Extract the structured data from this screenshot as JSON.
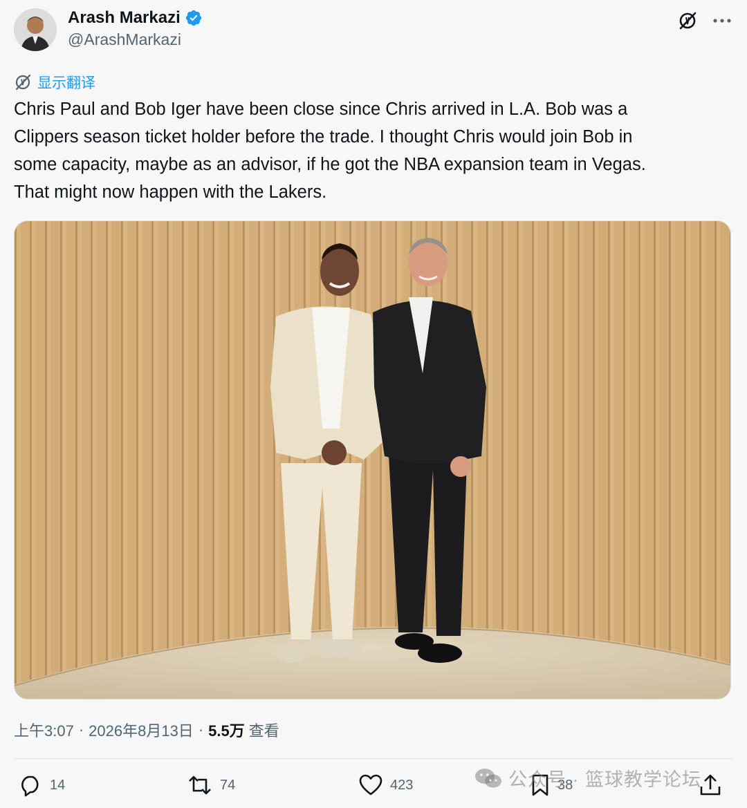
{
  "author": {
    "display_name": "Arash Markazi",
    "handle": "@ArashMarkazi",
    "verified": true
  },
  "translate": {
    "label": "显示翻译"
  },
  "tweet": {
    "lines": [
      "Chris Paul and Bob Iger have been close since Chris arrived in L.A. Bob was a",
      "Clippers season ticket holder before the trade. I thought Chris would join Bob in",
      "some capacity, maybe as an advisor, if he got the NBA expansion team in Vegas.",
      "That might now happen with the Lakers."
    ]
  },
  "meta": {
    "time": "上午3:07",
    "separator": "·",
    "date": "2026年8月13日",
    "views_count": "5.5万",
    "views_label": "查看"
  },
  "actions": {
    "replies": "14",
    "reposts": "74",
    "likes": "423",
    "bookmarks": "38"
  },
  "watermark": {
    "text": "公众号 · 篮球教学论坛"
  },
  "icons": {
    "translate": "no-translate-icon",
    "more": "more-dots-icon",
    "reply": "reply-icon",
    "repost": "repost-icon",
    "like": "heart-icon",
    "bookmark": "bookmark-icon",
    "share": "share-icon"
  },
  "colors": {
    "accent": "#1d9bf0",
    "text": "#0f1419",
    "muted": "#536471",
    "background": "#f7f7f7"
  }
}
